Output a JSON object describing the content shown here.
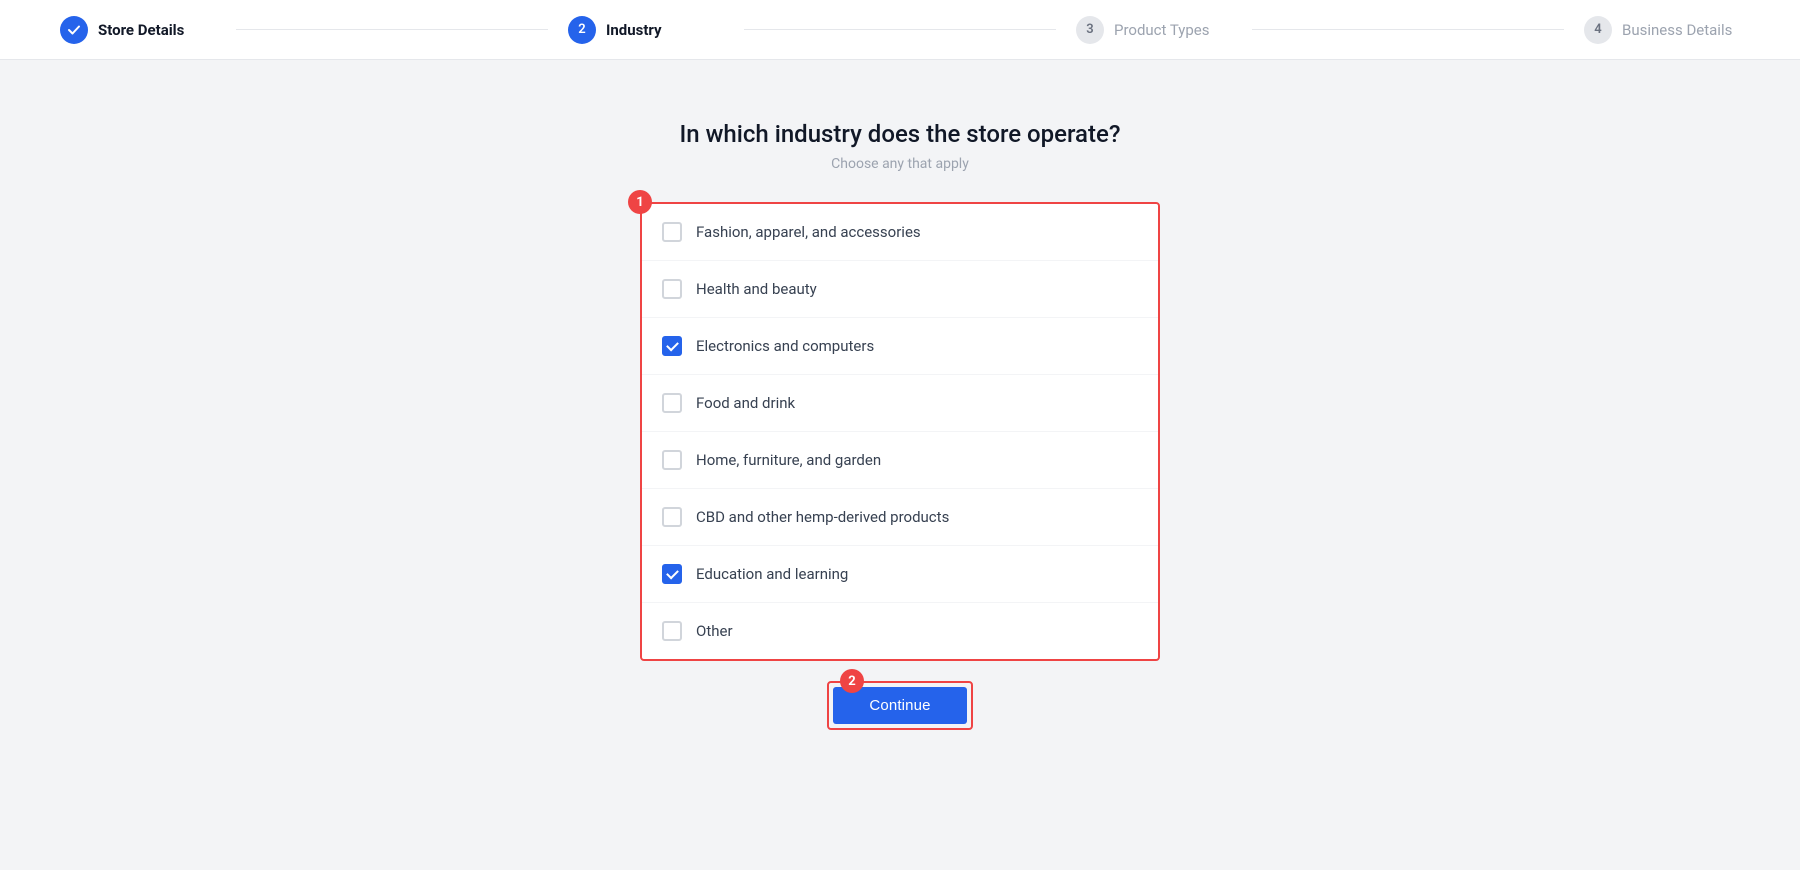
{
  "stepper": {
    "steps": [
      {
        "id": "store-details",
        "number": "✓",
        "label": "Store Details",
        "state": "done"
      },
      {
        "id": "industry",
        "number": "2",
        "label": "Industry",
        "state": "active"
      },
      {
        "id": "product-types",
        "number": "3",
        "label": "Product Types",
        "state": "inactive"
      },
      {
        "id": "business-details",
        "number": "4",
        "label": "Business Details",
        "state": "inactive"
      }
    ]
  },
  "page": {
    "title": "In which industry does the store operate?",
    "subtitle": "Choose any that apply",
    "annotation1": "1",
    "annotation2": "2"
  },
  "industries": [
    {
      "id": "fashion",
      "label": "Fashion, apparel, and accessories",
      "checked": false
    },
    {
      "id": "health",
      "label": "Health and beauty",
      "checked": false
    },
    {
      "id": "electronics",
      "label": "Electronics and computers",
      "checked": true
    },
    {
      "id": "food",
      "label": "Food and drink",
      "checked": false
    },
    {
      "id": "home",
      "label": "Home, furniture, and garden",
      "checked": false
    },
    {
      "id": "cbd",
      "label": "CBD and other hemp-derived products",
      "checked": false
    },
    {
      "id": "education",
      "label": "Education and learning",
      "checked": true
    },
    {
      "id": "other",
      "label": "Other",
      "checked": false
    }
  ],
  "buttons": {
    "continue": "Continue"
  }
}
